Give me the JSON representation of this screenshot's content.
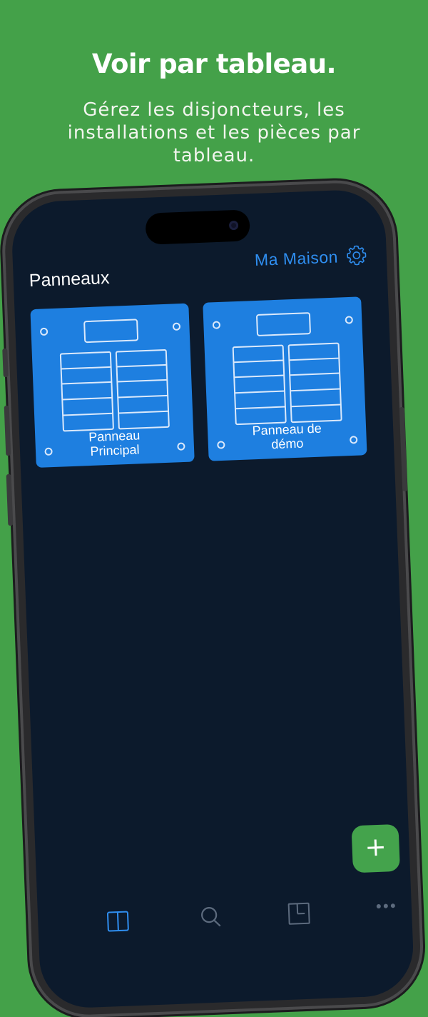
{
  "header": {
    "headline": "Voir par tableau.",
    "subline": "Gérez les disjoncteurs, les installations  et les pièces par tableau."
  },
  "app": {
    "screen_title": "Panneaux",
    "home_name": "Ma Maison",
    "panels": [
      {
        "label_line1": "Panneau",
        "label_line2": "Principal"
      },
      {
        "label_line1": "Panneau de",
        "label_line2": "démo"
      }
    ],
    "add_label": "+",
    "tabs": [
      {
        "icon": "panel-icon"
      },
      {
        "icon": "search-icon"
      },
      {
        "icon": "floorplan-icon"
      },
      {
        "icon": "more-icon"
      }
    ]
  },
  "colors": {
    "background": "#44a149",
    "screen": "#0c1a2c",
    "accent": "#2f8ef0",
    "card": "#1e7fe0",
    "fab": "#44a34c"
  }
}
